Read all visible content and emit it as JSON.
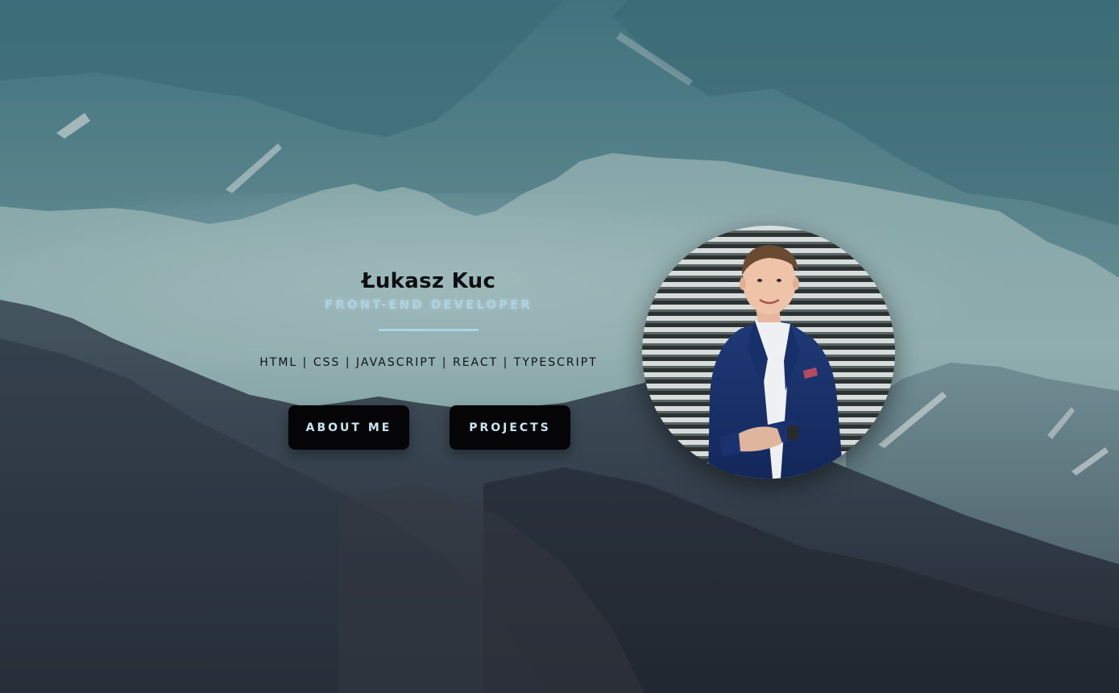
{
  "profile": {
    "name": "Łukasz Kuc",
    "role": "FRONT-END DEVELOPER",
    "skills": "HTML | CSS | JAVASCRIPT | REACT | TYPESCRIPT"
  },
  "buttons": {
    "about_label": "ABOUT ME",
    "projects_label": "PROJECTS"
  },
  "colors": {
    "accent": "#a8d4e4",
    "button_bg": "#050507",
    "sky": "#a9c8c9",
    "mountains_dark": "#2d3540"
  },
  "images": {
    "background": "mountain-landscape",
    "avatar": "profile-photo-man-in-blue-suit"
  }
}
